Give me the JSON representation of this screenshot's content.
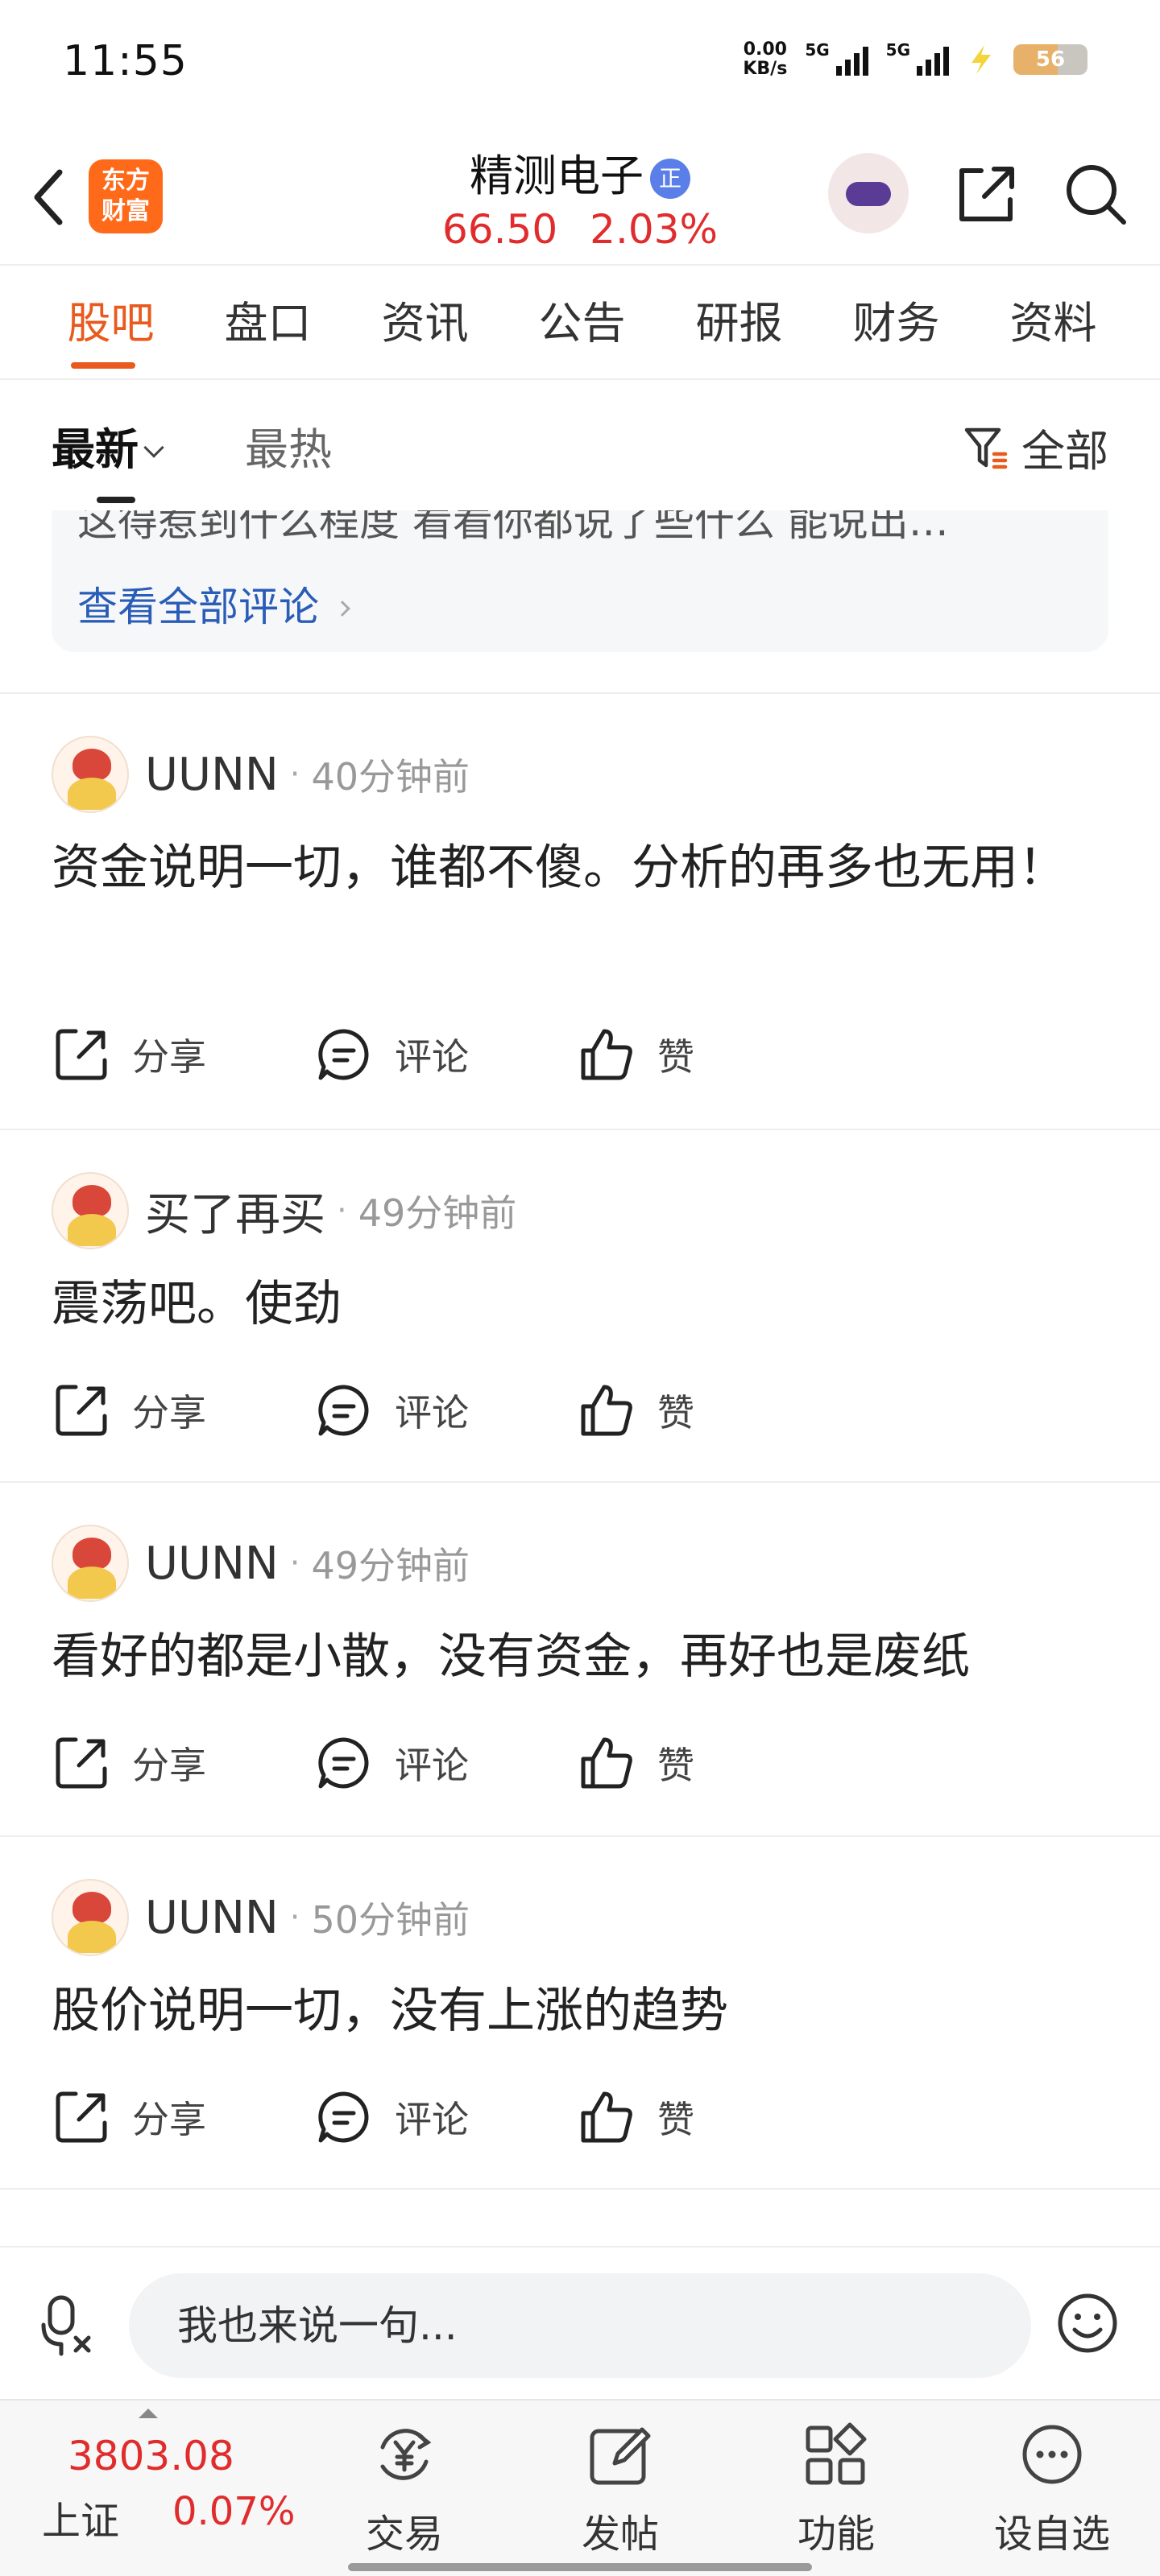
{
  "status_bar": {
    "time": "11:55",
    "speed_value": "0.00",
    "speed_unit": "KB/s",
    "net1": "5G",
    "net2": "5G",
    "battery": "56"
  },
  "header": {
    "logo_line1": "东方",
    "logo_line2": "财富",
    "stock_name": "精测电子",
    "badge": "正",
    "price": "66.50",
    "change_pct": "2.03%"
  },
  "tabs": [
    "股吧",
    "盘口",
    "资讯",
    "公告",
    "研报",
    "财务",
    "资料"
  ],
  "sort": {
    "latest": "最新",
    "hot": "最热",
    "filter": "全部"
  },
  "preview": {
    "truncated_text": "这得惹到什么程度 看看你都说了些什么 能说出…",
    "view_all": "查看全部评论"
  },
  "actions": {
    "share": "分享",
    "comment": "评论",
    "like": "赞"
  },
  "posts": [
    {
      "user": "UUNN",
      "time": "40分钟前",
      "text": "资金说明一切，谁都不傻。分析的再多也无用！"
    },
    {
      "user": "买了再买",
      "time": "49分钟前",
      "text": "震荡吧。使劲"
    },
    {
      "user": "UUNN",
      "time": "49分钟前",
      "text": "看好的都是小散，没有资金，再好也是废纸"
    },
    {
      "user": "UUNN",
      "time": "50分钟前",
      "text": "股价说明一切，没有上涨的趋势"
    }
  ],
  "comment_bar": {
    "placeholder": "我也来说一句..."
  },
  "bottom_nav": {
    "index_value": "3803.08",
    "index_name": "上证",
    "index_pct": "0.07%",
    "items": [
      "交易",
      "发帖",
      "功能",
      "设自选"
    ]
  }
}
